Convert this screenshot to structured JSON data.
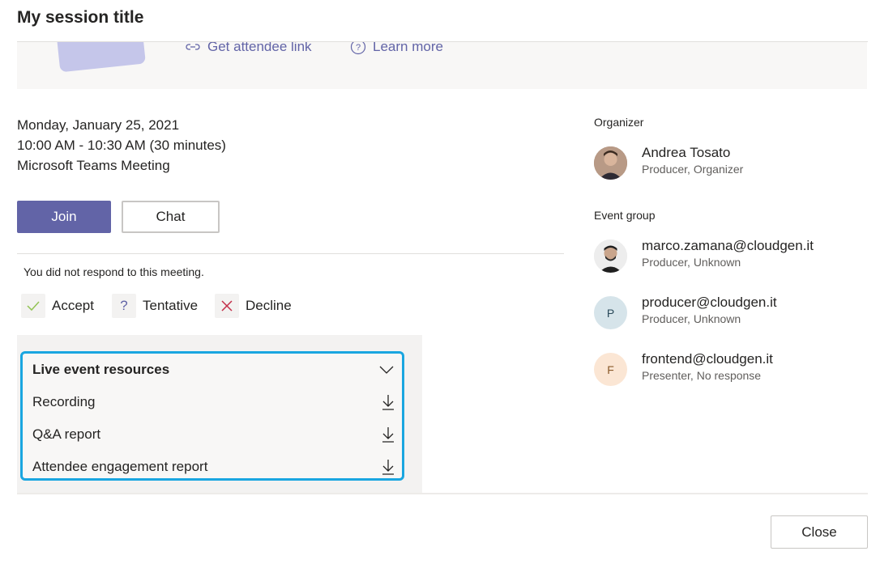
{
  "dialog": {
    "title": "My session title"
  },
  "banner": {
    "attendee_link": "Get attendee link",
    "learn_more": "Learn more"
  },
  "meeting": {
    "date": "Monday, January 25, 2021",
    "time": "10:00 AM - 10:30 AM (30 minutes)",
    "type": "Microsoft Teams Meeting"
  },
  "actions": {
    "join": "Join",
    "chat": "Chat"
  },
  "response": {
    "status": "You did not respond to this meeting.",
    "accept": "Accept",
    "tentative": "Tentative",
    "decline": "Decline"
  },
  "resources": {
    "heading": "Live event resources",
    "items": [
      "Recording",
      "Q&A report",
      "Attendee engagement report"
    ]
  },
  "organizer": {
    "label": "Organizer",
    "name": "Andrea Tosato",
    "role": "Producer, Organizer"
  },
  "event_group": {
    "label": "Event group",
    "members": [
      {
        "name": "marco.zamana@cloudgen.it",
        "role": "Producer, Unknown",
        "initial": ""
      },
      {
        "name": "producer@cloudgen.it",
        "role": "Producer, Unknown",
        "initial": "P"
      },
      {
        "name": "frontend@cloudgen.it",
        "role": "Presenter, No response",
        "initial": "F"
      }
    ]
  },
  "footer": {
    "close": "Close"
  },
  "colors": {
    "accent": "#6264a7",
    "highlight": "#1aa6e0",
    "decline": "#c4314b",
    "accept": "#92c353"
  }
}
